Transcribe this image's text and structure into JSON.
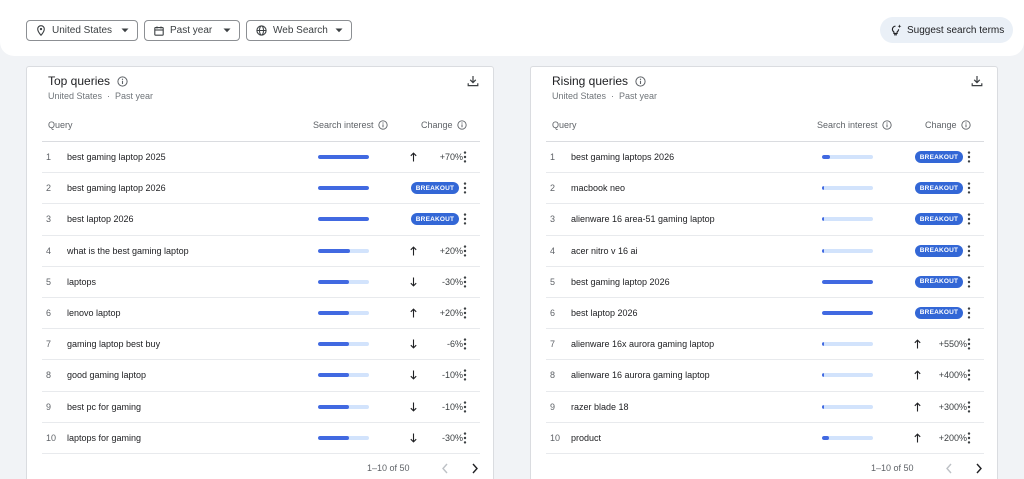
{
  "filters": {
    "location": "United States",
    "time": "Past year",
    "property": "Web Search",
    "suggest_label": "Suggest search terms"
  },
  "colors": {
    "accent": "#4169e1",
    "breakout": "#3367d6",
    "bar_track": "#d2e3fc"
  },
  "top": {
    "title": "Top queries",
    "subtitle_location": "United States",
    "subtitle_time": "Past year",
    "headers": {
      "query": "Query",
      "interest": "Search interest",
      "change": "Change"
    },
    "rows": [
      {
        "rank": "1",
        "query": "best gaming laptop 2025",
        "interest": 100,
        "dir": "up",
        "change": "+70%"
      },
      {
        "rank": "2",
        "query": "best gaming laptop 2026",
        "interest": 100,
        "breakout": "BREAKOUT"
      },
      {
        "rank": "3",
        "query": "best laptop 2026",
        "interest": 100,
        "breakout": "BREAKOUT"
      },
      {
        "rank": "4",
        "query": "what is the best gaming laptop",
        "interest": 62,
        "dir": "up",
        "change": "+20%"
      },
      {
        "rank": "5",
        "query": "laptops",
        "interest": 60,
        "dir": "down",
        "change": "-30%"
      },
      {
        "rank": "6",
        "query": "lenovo laptop",
        "interest": 60,
        "dir": "up",
        "change": "+20%"
      },
      {
        "rank": "7",
        "query": "gaming laptop best buy",
        "interest": 60,
        "dir": "down",
        "change": "-6%"
      },
      {
        "rank": "8",
        "query": "good gaming laptop",
        "interest": 60,
        "dir": "down",
        "change": "-10%"
      },
      {
        "rank": "9",
        "query": "best pc for gaming",
        "interest": 60,
        "dir": "down",
        "change": "-10%"
      },
      {
        "rank": "10",
        "query": "laptops for gaming",
        "interest": 60,
        "dir": "down",
        "change": "-30%"
      }
    ],
    "pager": "1–10 of 50"
  },
  "rising": {
    "title": "Rising queries",
    "subtitle_location": "United States",
    "subtitle_time": "Past year",
    "headers": {
      "query": "Query",
      "interest": "Search interest",
      "change": "Change"
    },
    "rows": [
      {
        "rank": "1",
        "query": "best gaming laptops 2026",
        "interest": 16,
        "breakout": "BREAKOUT"
      },
      {
        "rank": "2",
        "query": "macbook neo",
        "interest": 4,
        "breakout": "BREAKOUT"
      },
      {
        "rank": "3",
        "query": "alienware 16 area-51 gaming laptop",
        "interest": 4,
        "breakout": "BREAKOUT"
      },
      {
        "rank": "4",
        "query": "acer nitro v 16 ai",
        "interest": 4,
        "breakout": "BREAKOUT"
      },
      {
        "rank": "5",
        "query": "best gaming laptop 2026",
        "interest": 100,
        "breakout": "BREAKOUT"
      },
      {
        "rank": "6",
        "query": "best laptop 2026",
        "interest": 100,
        "breakout": "BREAKOUT"
      },
      {
        "rank": "7",
        "query": "alienware 16x aurora gaming laptop",
        "interest": 4,
        "dir": "up",
        "change": "+550%"
      },
      {
        "rank": "8",
        "query": "alienware 16 aurora gaming laptop",
        "interest": 4,
        "dir": "up",
        "change": "+400%"
      },
      {
        "rank": "9",
        "query": "razer blade 18",
        "interest": 4,
        "dir": "up",
        "change": "+300%"
      },
      {
        "rank": "10",
        "query": "product",
        "interest": 14,
        "dir": "up",
        "change": "+200%"
      }
    ],
    "pager": "1–10 of 50"
  }
}
